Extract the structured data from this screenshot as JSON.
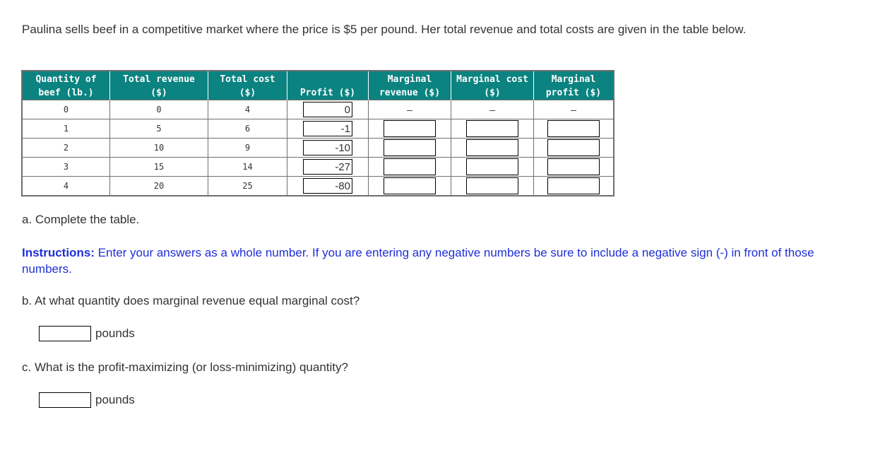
{
  "intro": "Paulina sells beef in a competitive market where the price is $5 per pound. Her total revenue and total costs are given in the table below.",
  "table": {
    "headers": [
      "Quantity of beef (lb.)",
      "Total revenue ($)",
      "Total cost ($)",
      "Profit ($)",
      "Marginal revenue ($)",
      "Marginal cost ($)",
      "Marginal profit ($)"
    ],
    "rows": [
      {
        "quantity": "0",
        "total_revenue": "0",
        "total_cost": "4",
        "profit": "0",
        "mr": "–",
        "mc": "–",
        "mp": "–"
      },
      {
        "quantity": "1",
        "total_revenue": "5",
        "total_cost": "6",
        "profit": "-1",
        "mr": "",
        "mc": "",
        "mp": ""
      },
      {
        "quantity": "2",
        "total_revenue": "10",
        "total_cost": "9",
        "profit": "-10",
        "mr": "",
        "mc": "",
        "mp": ""
      },
      {
        "quantity": "3",
        "total_revenue": "15",
        "total_cost": "14",
        "profit": "-27",
        "mr": "",
        "mc": "",
        "mp": ""
      },
      {
        "quantity": "4",
        "total_revenue": "20",
        "total_cost": "25",
        "profit": "-80",
        "mr": "",
        "mc": "",
        "mp": ""
      }
    ]
  },
  "part_a": "a. Complete the table.",
  "instructions": {
    "label": "Instructions:",
    "text": " Enter your answers as a whole number. If you are entering any negative numbers be sure to include a negative sign (-) in front of those numbers."
  },
  "part_b": {
    "question": "b. At what quantity does marginal revenue equal marginal cost?",
    "answer": "",
    "unit": "pounds"
  },
  "part_c": {
    "question": "c. What is the profit-maximizing (or loss-minimizing) quantity?",
    "answer": "",
    "unit": "pounds"
  },
  "colors": {
    "header_bg": "#0b8380",
    "instructions": "#1f2fd6"
  }
}
